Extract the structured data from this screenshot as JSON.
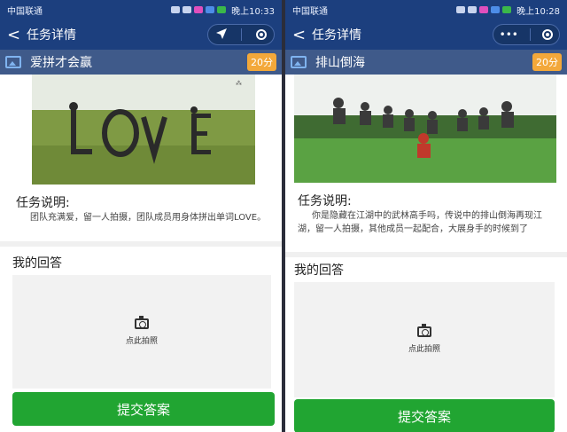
{
  "left": {
    "status": {
      "carrier": "中国联通",
      "time": "晚上10:33"
    },
    "nav": {
      "back": "<",
      "title": "任务详情"
    },
    "task": {
      "name": "爱拼才会赢",
      "score": "20分"
    },
    "description": {
      "title": "任务说明:",
      "text": "团队充满爱，留一人拍摄，团队成员用身体拼出单词LOVE。"
    },
    "answer": {
      "label": "我的回答",
      "upload_text": "点此拍照"
    },
    "submit_label": "提交答案"
  },
  "right": {
    "status": {
      "carrier": "中国联通",
      "time": "晚上10:28"
    },
    "nav": {
      "back": "<",
      "title": "任务详情",
      "capsule_dots": "•••"
    },
    "task": {
      "name": "排山倒海",
      "score": "20分"
    },
    "description": {
      "title": "任务说明:",
      "text": "你是隐藏在江湖中的武林高手吗，传说中的排山倒海再现江湖，留一人拍摄，其他成员一起配合，大展身手的时候到了"
    },
    "answer": {
      "label": "我的回答",
      "upload_text": "点此拍照"
    },
    "submit_label": "提交答案"
  },
  "colors": {
    "nav_bg": "#1c3f7e",
    "submit_green": "#21a532",
    "score_orange": "#f3a83a"
  },
  "icons": [
    "back-arrow-icon",
    "location-arrow-icon",
    "record-ring-icon",
    "more-dots-icon",
    "image-icon",
    "camera-icon",
    "signal-icon",
    "wifi-icon",
    "battery-icon"
  ]
}
